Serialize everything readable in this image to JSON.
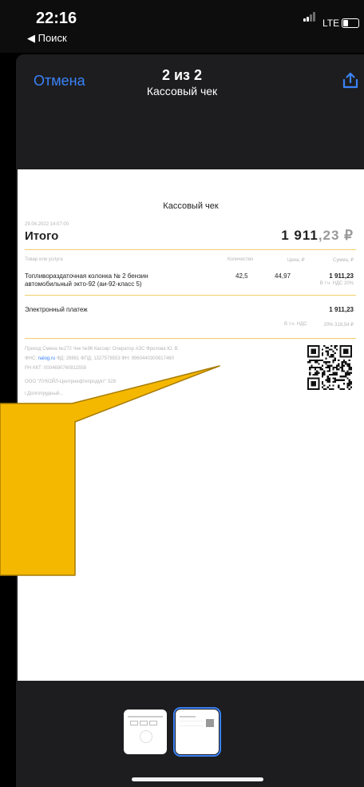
{
  "status_bar": {
    "time": "22:16",
    "back_app": "◀ Поиск",
    "network": "LTE",
    "battery_level": 0.3
  },
  "header": {
    "cancel": "Отмена",
    "page_counter": "2 из 2",
    "doc_title": "Кассовый чек"
  },
  "receipt": {
    "title": "Кассовый чек",
    "datetime": "29.04.2022  14:07:00",
    "total_label": "Итого",
    "total_int": "1 911",
    "total_frac": ",23 ₽",
    "columns": [
      "Товар или услуга",
      "Количество",
      "Цена, ₽",
      "Сумма, ₽"
    ],
    "item": {
      "name_line1": "Топливораздаточная колонка № 2 бензин",
      "name_line2": "автомобильный экто-92 (аи-92-класс 5)",
      "qty": "42,5",
      "price": "44,97",
      "sum": "1 911,23",
      "vat_note": "В т.ч. НДС 20%"
    },
    "payment_label": "Электронный платеж",
    "payment_sum": "1 911,23",
    "vat_label": "В т.ч. НДС",
    "vat_value": "20%  318,54 ₽",
    "info_line1": "Приход    Смена №272    Чек №96    Кассир: Оператор АЗС Фролова Ю. В.",
    "fns_label": "ФНС:",
    "fns_site": "nalog.ru",
    "info_line2_rest": "ФД: 29861    ФПД: 1327578553    ФН: 9960440300817460",
    "info_line3": "РН ККТ: 0004690760811558",
    "org_line": "ООО \"ЛУКОЙЛ-Центрнефтепродукт\"                         528",
    "address_line": "г.Долгопрудный..."
  },
  "thumbnails": {
    "count": 2,
    "selected_index": 1
  },
  "colors": {
    "accent": "#3a82f7",
    "callout": "#f5b800",
    "receipt_rule": "#f0cf6a"
  }
}
